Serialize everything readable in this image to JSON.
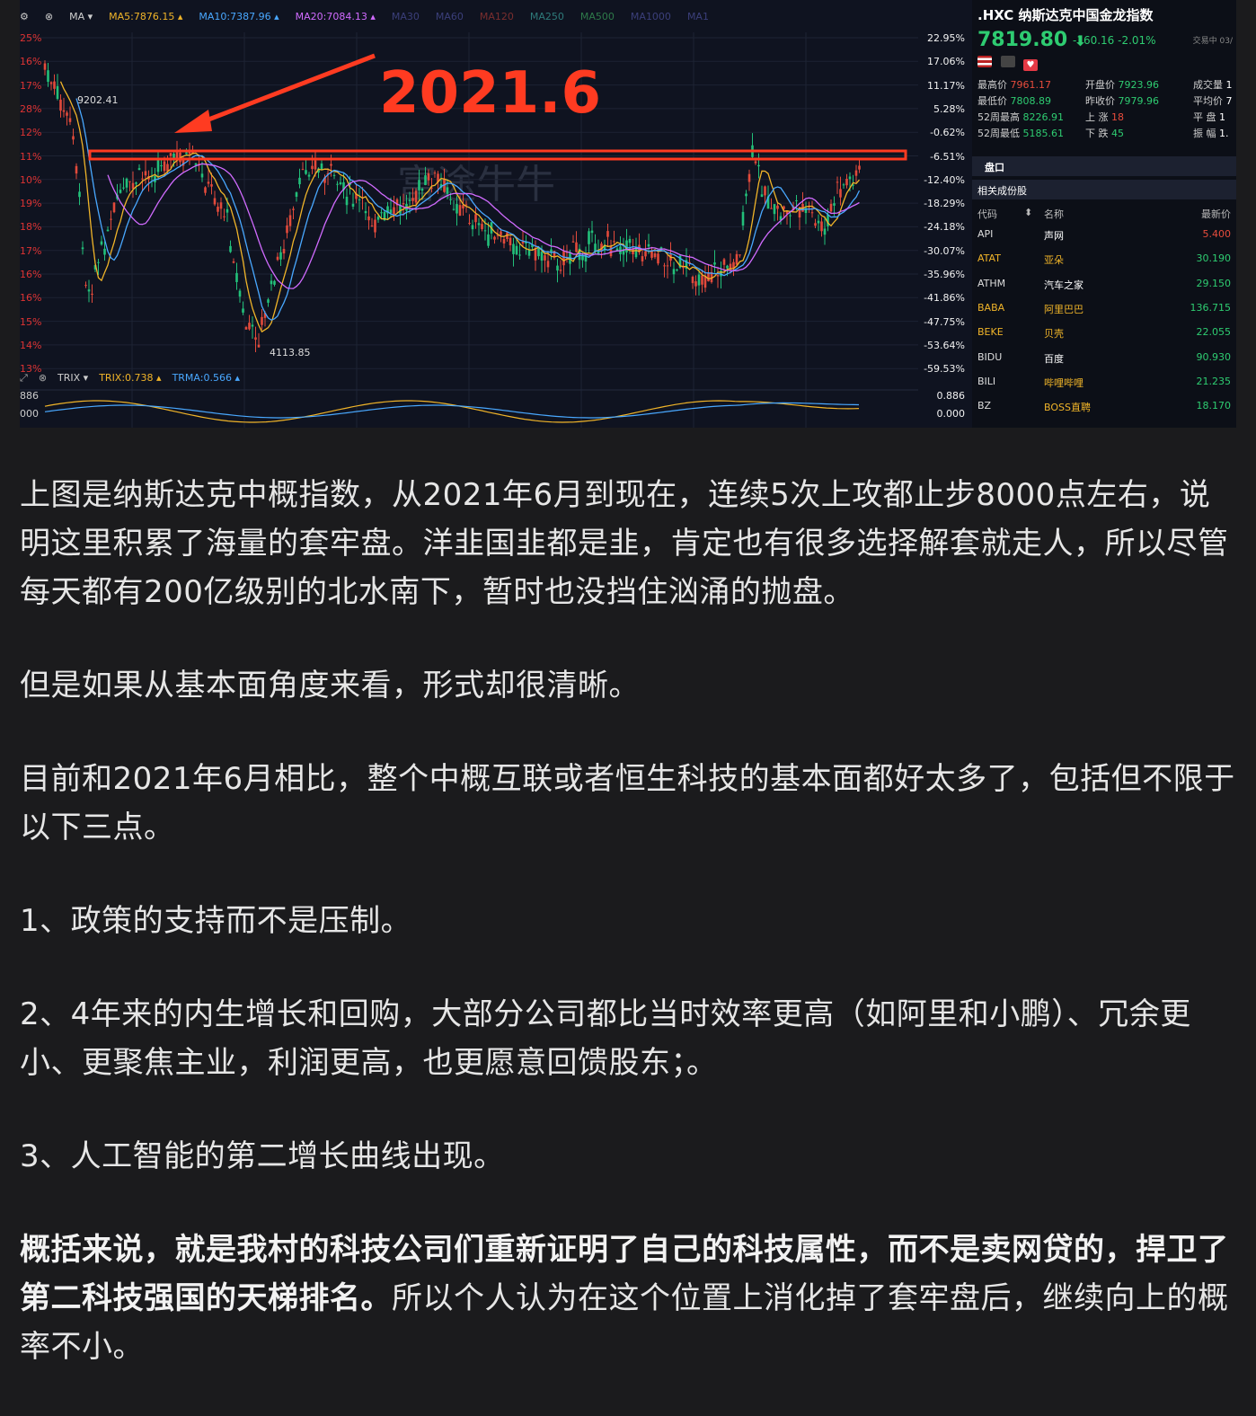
{
  "chart_panel": {
    "ma_items": [
      {
        "text": "MA ▾",
        "color": "#cfcfcf"
      },
      {
        "text": "MA5:7876.15 ▴",
        "color": "#f0b429"
      },
      {
        "text": "MA10:7387.96 ▴",
        "color": "#49a8ff"
      },
      {
        "text": "MA20:7084.13 ▴",
        "color": "#d16bff"
      },
      {
        "text": "MA30",
        "color": "#3b3f7a"
      },
      {
        "text": "MA60",
        "color": "#3b3f7a"
      },
      {
        "text": "MA120",
        "color": "#7a2e2e"
      },
      {
        "text": "MA250",
        "color": "#2e7a7a"
      },
      {
        "text": "MA500",
        "color": "#2e7a4a"
      },
      {
        "text": "MA1000",
        "color": "#3b3f7a"
      },
      {
        "text": "MA1",
        "color": "#3b3f7a"
      }
    ],
    "annotation": "2021.6",
    "high_label": "9202.41",
    "low_label": "4113.85",
    "pct_ticks": [
      "22.95%",
      "17.06%",
      "11.17%",
      "5.28%",
      "-0.62%",
      "-6.51%",
      "-12.40%",
      "-18.29%",
      "-24.18%",
      "-30.07%",
      "-35.96%",
      "-41.86%",
      "-47.75%",
      "-53.64%",
      "-59.53%"
    ],
    "left_ticks": [
      "25%",
      "16%",
      "17%",
      "28%",
      "12%",
      "11%",
      "10%",
      "19%",
      "18%",
      "17%",
      "16%",
      "16%",
      "15%",
      "14%",
      "13%"
    ],
    "trix_items": [
      {
        "text": "TRIX ▾",
        "color": "#cfcfcf"
      },
      {
        "text": "TRIX:0.738 ▴",
        "color": "#f0b429"
      },
      {
        "text": "TRMA:0.566 ▴",
        "color": "#49a8ff"
      }
    ],
    "trix_right": [
      "0.886",
      "0.000"
    ],
    "trix_left": [
      "886",
      "000"
    ],
    "watermark": "富途牛牛"
  },
  "side_panel": {
    "title": ".HXC 纳斯达克中国金龙指数",
    "price": "7819.80",
    "arrow": "⬇",
    "change": "-160.16 -2.01%",
    "time": "交易中 03/",
    "stats": [
      [
        "最高价",
        "7961.17",
        "开盘价",
        "7923.96",
        "成交量",
        "1"
      ],
      [
        "最低价",
        "7808.89",
        "昨收价",
        "7979.96",
        "平均价",
        "7"
      ],
      [
        "52周最高",
        "8226.91",
        "上 涨",
        "18",
        "平 盘",
        "1"
      ],
      [
        "52周最低",
        "5185.61",
        "下 跌",
        "45",
        "振 幅",
        "1."
      ]
    ],
    "tab_label": "盘口",
    "related_label": "相关成份股",
    "table_headers": [
      "代码",
      "名称",
      "最新价"
    ],
    "rows": [
      {
        "code": "API",
        "name": "声网",
        "price": "5.400"
      },
      {
        "code": "ATAT",
        "name": "亚朵",
        "price": "30.190"
      },
      {
        "code": "ATHM",
        "name": "汽车之家",
        "price": "29.150"
      },
      {
        "code": "BABA",
        "name": "阿里巴巴",
        "price": "136.715"
      },
      {
        "code": "BEKE",
        "name": "贝壳",
        "price": "22.055"
      },
      {
        "code": "BIDU",
        "name": "百度",
        "price": "90.930"
      },
      {
        "code": "BILI",
        "name": "哔哩哔哩",
        "price": "21.235"
      },
      {
        "code": "BZ",
        "name": "BOSS直聘",
        "price": "18.170"
      }
    ]
  },
  "article": {
    "p1": "上图是纳斯达克中概指数，从2021年6月到现在，连续5次上攻都止步8000点左右，说明这里积累了海量的套牢盘。洋韭国韭都是韭，肯定也有很多选择解套就走人，所以尽管每天都有200亿级别的北水南下，暂时也没挡住汹涌的抛盘。",
    "p2": "但是如果从基本面角度来看，形式却很清晰。",
    "p3": "目前和2021年6月相比，整个中概互联或者恒生科技的基本面都好太多了，包括但不限于以下三点。",
    "p4": "1、政策的支持而不是压制。",
    "p5": "2、4年来的内生增长和回购，大部分公司都比当时效率更高（如阿里和小鹏）、冗余更小、更聚焦主业，利润更高，也更愿意回馈股东；。",
    "p6": "3、人工智能的第二增长曲线出现。",
    "p7_bold": "概括来说，就是我村的科技公司们重新证明了自己的科技属性，而不是卖网贷的，捍卫了第二科技强国的天梯排名。",
    "p7_rest": "所以个人认为在这个位置上消化掉了套牢盘后，继续向上的概率不小。"
  }
}
